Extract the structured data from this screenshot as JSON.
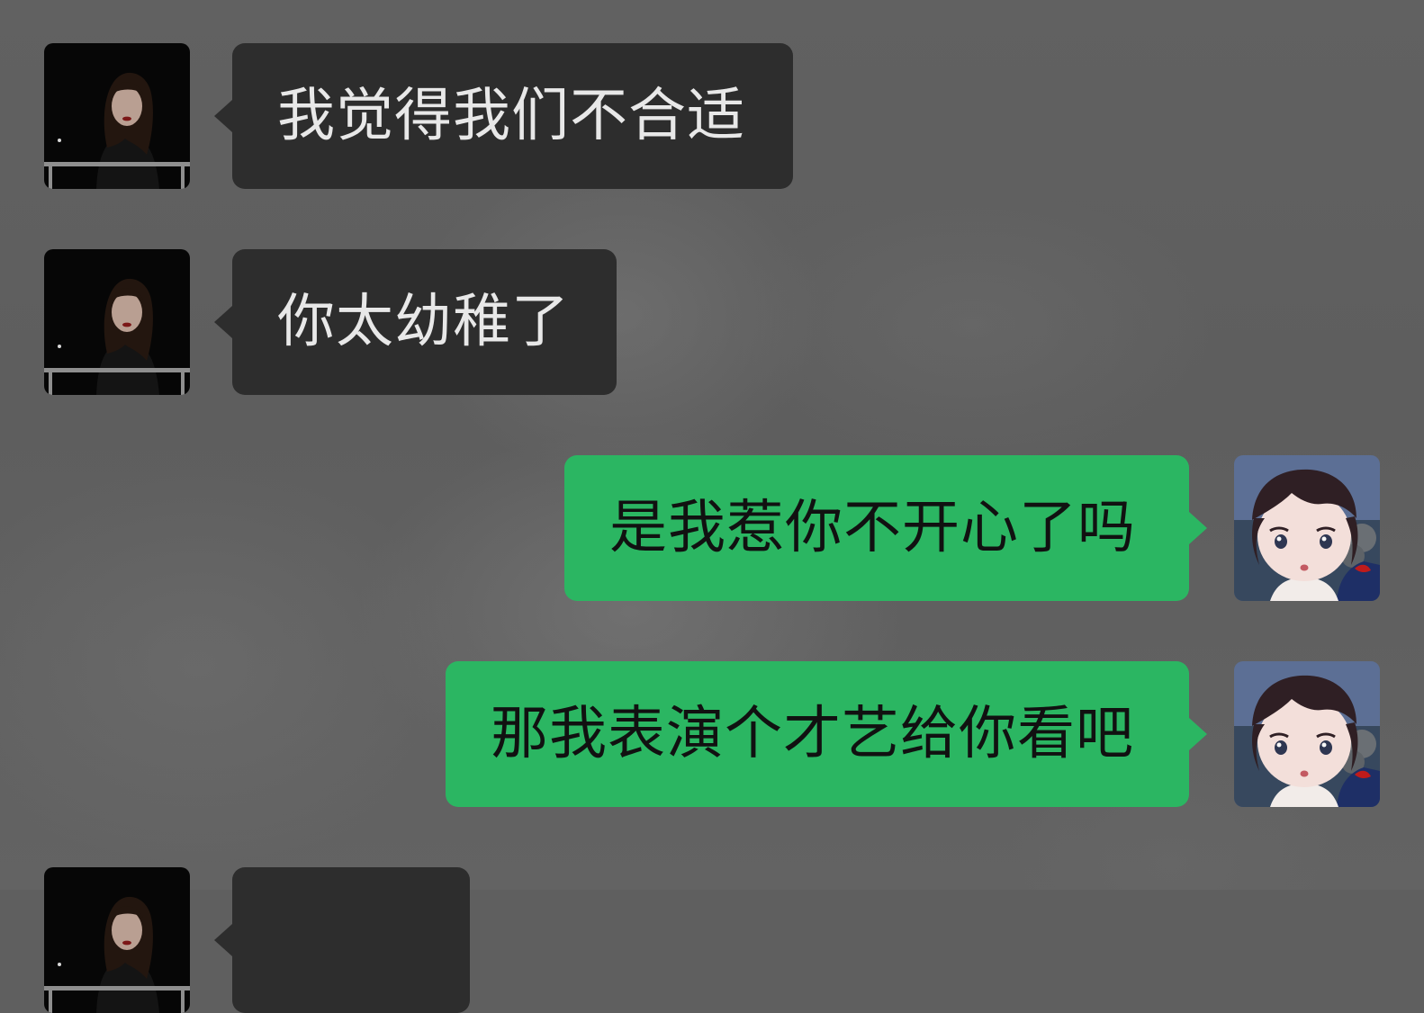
{
  "chat": {
    "messages": [
      {
        "direction": "incoming",
        "text": "我觉得我们不合适"
      },
      {
        "direction": "incoming",
        "text": "你太幼稚了"
      },
      {
        "direction": "outgoing",
        "text": "是我惹你不开心了吗"
      },
      {
        "direction": "outgoing",
        "text": "那我表演个才艺给你看吧"
      },
      {
        "direction": "incoming",
        "text": ""
      }
    ]
  },
  "colors": {
    "background": "#5f5f5f",
    "incoming_bubble": "#2d2d2d",
    "incoming_text": "#e8e8e8",
    "outgoing_bubble": "#2bb662",
    "outgoing_text": "#111111"
  },
  "icons": {
    "contact_avatar": "woman-portrait-avatar",
    "self_avatar": "anime-boy-avatar"
  }
}
